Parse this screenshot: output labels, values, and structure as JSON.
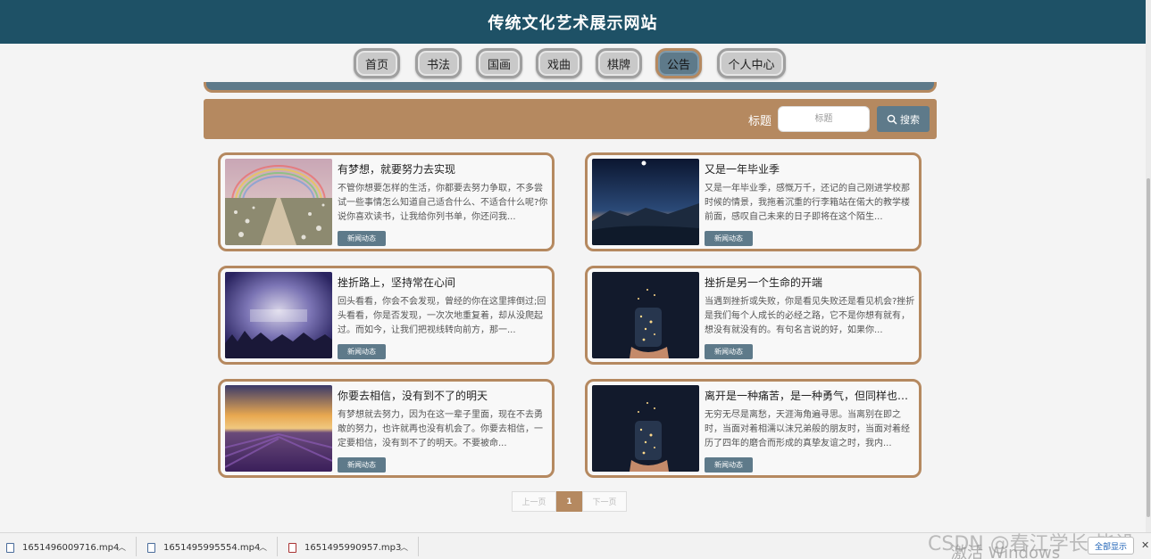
{
  "header": {
    "title": "传统文化艺术展示网站"
  },
  "nav": {
    "items": [
      {
        "label": "首页",
        "active": false
      },
      {
        "label": "书法",
        "active": false
      },
      {
        "label": "国画",
        "active": false
      },
      {
        "label": "戏曲",
        "active": false
      },
      {
        "label": "棋牌",
        "active": false
      },
      {
        "label": "公告",
        "active": true
      },
      {
        "label": "个人中心",
        "active": false
      }
    ]
  },
  "search": {
    "label": "标题",
    "placeholder": "标题",
    "button_label": "搜索"
  },
  "cards": [
    {
      "title": "有梦想，就要努力去实现",
      "desc": "不管你想要怎样的生活，你都要去努力争取，不多尝试一些事情怎么知道自己适合什么、不适合什么呢?你说你喜欢读书，让我给你列书单，你还问我...",
      "tag": "新闻动态",
      "image": "rainbow-flower-path"
    },
    {
      "title": "又是一年毕业季",
      "desc": "又是一年毕业季，感慨万千，还记的自己刚进学校那时候的情景，我拖着沉重的行李箱站在偌大的教学楼前面，感叹自己未来的日子即将在这个陌生...",
      "tag": "新闻动态",
      "image": "night-lake-moon"
    },
    {
      "title": "挫折路上，坚持常在心间",
      "desc": "回头看看，你会不会发现，曾经的你在这里摔倒过;回头看看，你是否发现，一次次地重复着，却从没爬起过。而如今，让我们把视线转向前方，那一...",
      "tag": "新闻动态",
      "image": "purple-sky-grass"
    },
    {
      "title": "挫折是另一个生命的开端",
      "desc": "当遇到挫折或失败，你是看见失败还是看见机会?挫折是我们每个人成长的必经之路，它不是你想有就有，想没有就没有的。有句名言说的好，如果你...",
      "tag": "新闻动态",
      "image": "starry-jar"
    },
    {
      "title": "你要去相信，没有到不了的明天",
      "desc": "有梦想就去努力，因为在这一辈子里面，现在不去勇敢的努力，也许就再也没有机会了。你要去相信，一定要相信，没有到不了的明天。不要被命...",
      "tag": "新闻动态",
      "image": "lavender-sunset"
    },
    {
      "title": "离开是一种痛苦，是一种勇气，但同样也是一...",
      "desc": "无穷无尽是离愁，天涯海角遍寻思。当离别在即之时，当面对着相濡以沫兄弟般的朋友时，当面对着经历了四年的磨合而形成的真挚友谊之时，我内...",
      "tag": "新闻动态",
      "image": "starry-jar"
    }
  ],
  "pager": {
    "prev": "上一页",
    "current": "1",
    "next": "下一页"
  },
  "downloads": [
    {
      "name": "1651496009716.mp4"
    },
    {
      "name": "1651495995554.mp4"
    },
    {
      "name": "1651495990957.mp3"
    }
  ],
  "download_bar": {
    "show_all": "全部显示"
  },
  "overlay": {
    "watermark": "CSDN @春江学长-毕设",
    "activate": "激活 Windows"
  },
  "colors": {
    "header": "#1e5166",
    "accent": "#b58960",
    "slate": "#5e7a8a"
  }
}
